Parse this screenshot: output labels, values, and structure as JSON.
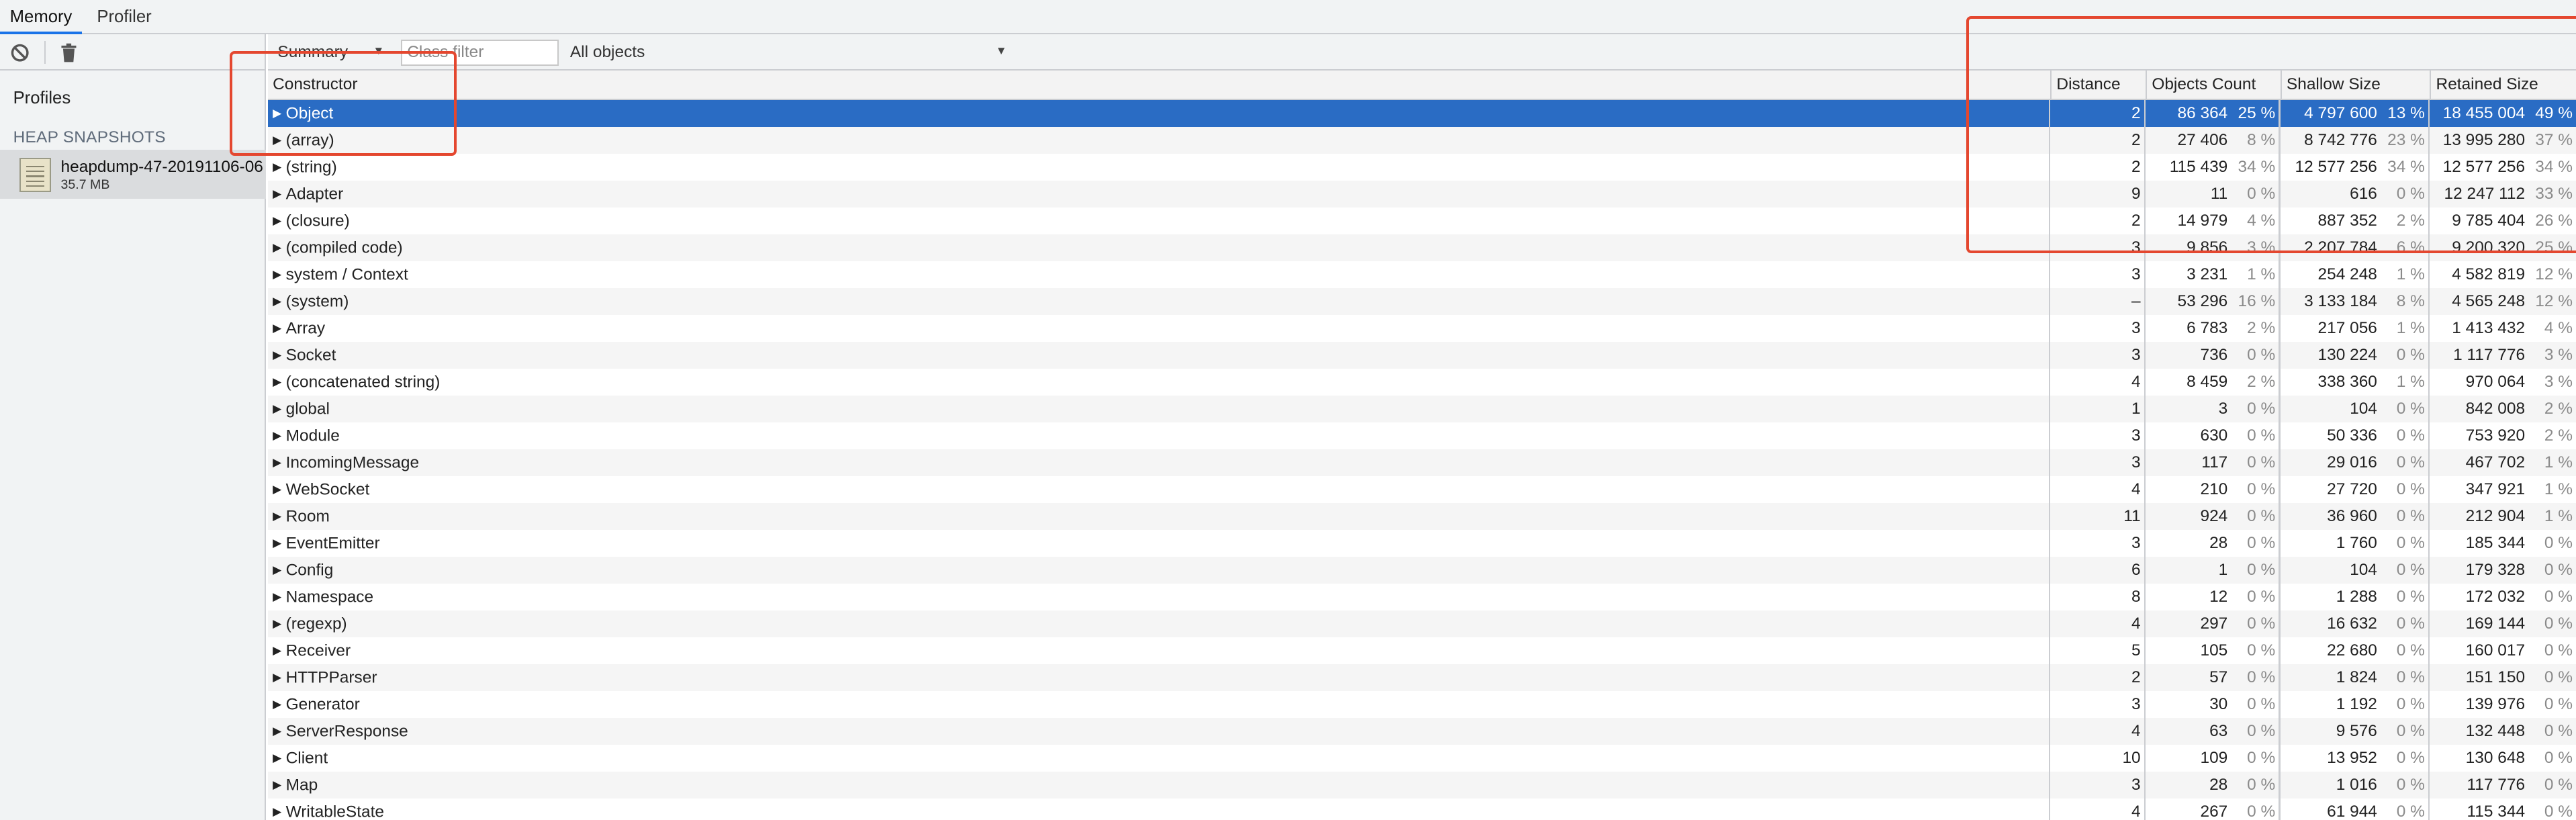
{
  "tabs": [
    "Memory",
    "Profiler"
  ],
  "left_panel": {
    "profiles_title": "Profiles",
    "section_title": "HEAP SNAPSHOTS",
    "snapshot": {
      "name": "heapdump-47-20191106-06",
      "size": "35.7 MB"
    }
  },
  "toolbar": {
    "view": "Summary",
    "class_filter_placeholder": "Class filter",
    "objects_filter": "All objects"
  },
  "table": {
    "columns": {
      "constructor": "Constructor",
      "distance": "Distance",
      "objects_count": "Objects Count",
      "shallow_size": "Shallow Size",
      "retained_size": "Retained Size"
    },
    "rows": [
      {
        "name": "Object",
        "distance": "2",
        "count": "86 364",
        "count_pct": "25 %",
        "shallow": "4 797 600",
        "shallow_pct": "13 %",
        "retained": "18 455 004",
        "retained_pct": "49 %"
      },
      {
        "name": "(array)",
        "distance": "2",
        "count": "27 406",
        "count_pct": "8 %",
        "shallow": "8 742 776",
        "shallow_pct": "23 %",
        "retained": "13 995 280",
        "retained_pct": "37 %"
      },
      {
        "name": "(string)",
        "distance": "2",
        "count": "115 439",
        "count_pct": "34 %",
        "shallow": "12 577 256",
        "shallow_pct": "34 %",
        "retained": "12 577 256",
        "retained_pct": "34 %"
      },
      {
        "name": "Adapter",
        "distance": "9",
        "count": "11",
        "count_pct": "0 %",
        "shallow": "616",
        "shallow_pct": "0 %",
        "retained": "12 247 112",
        "retained_pct": "33 %"
      },
      {
        "name": "(closure)",
        "distance": "2",
        "count": "14 979",
        "count_pct": "4 %",
        "shallow": "887 352",
        "shallow_pct": "2 %",
        "retained": "9 785 404",
        "retained_pct": "26 %"
      },
      {
        "name": "(compiled code)",
        "distance": "3",
        "count": "9 856",
        "count_pct": "3 %",
        "shallow": "2 207 784",
        "shallow_pct": "6 %",
        "retained": "9 200 320",
        "retained_pct": "25 %"
      },
      {
        "name": "system / Context",
        "distance": "3",
        "count": "3 231",
        "count_pct": "1 %",
        "shallow": "254 248",
        "shallow_pct": "1 %",
        "retained": "4 582 819",
        "retained_pct": "12 %"
      },
      {
        "name": "(system)",
        "distance": "–",
        "count": "53 296",
        "count_pct": "16 %",
        "shallow": "3 133 184",
        "shallow_pct": "8 %",
        "retained": "4 565 248",
        "retained_pct": "12 %"
      },
      {
        "name": "Array",
        "distance": "3",
        "count": "6 783",
        "count_pct": "2 %",
        "shallow": "217 056",
        "shallow_pct": "1 %",
        "retained": "1 413 432",
        "retained_pct": "4 %"
      },
      {
        "name": "Socket",
        "distance": "3",
        "count": "736",
        "count_pct": "0 %",
        "shallow": "130 224",
        "shallow_pct": "0 %",
        "retained": "1 117 776",
        "retained_pct": "3 %"
      },
      {
        "name": "(concatenated string)",
        "distance": "4",
        "count": "8 459",
        "count_pct": "2 %",
        "shallow": "338 360",
        "shallow_pct": "1 %",
        "retained": "970 064",
        "retained_pct": "3 %"
      },
      {
        "name": "global",
        "distance": "1",
        "count": "3",
        "count_pct": "0 %",
        "shallow": "104",
        "shallow_pct": "0 %",
        "retained": "842 008",
        "retained_pct": "2 %"
      },
      {
        "name": "Module",
        "distance": "3",
        "count": "630",
        "count_pct": "0 %",
        "shallow": "50 336",
        "shallow_pct": "0 %",
        "retained": "753 920",
        "retained_pct": "2 %"
      },
      {
        "name": "IncomingMessage",
        "distance": "3",
        "count": "117",
        "count_pct": "0 %",
        "shallow": "29 016",
        "shallow_pct": "0 %",
        "retained": "467 702",
        "retained_pct": "1 %"
      },
      {
        "name": "WebSocket",
        "distance": "4",
        "count": "210",
        "count_pct": "0 %",
        "shallow": "27 720",
        "shallow_pct": "0 %",
        "retained": "347 921",
        "retained_pct": "1 %"
      },
      {
        "name": "Room",
        "distance": "11",
        "count": "924",
        "count_pct": "0 %",
        "shallow": "36 960",
        "shallow_pct": "0 %",
        "retained": "212 904",
        "retained_pct": "1 %"
      },
      {
        "name": "EventEmitter",
        "distance": "3",
        "count": "28",
        "count_pct": "0 %",
        "shallow": "1 760",
        "shallow_pct": "0 %",
        "retained": "185 344",
        "retained_pct": "0 %"
      },
      {
        "name": "Config",
        "distance": "6",
        "count": "1",
        "count_pct": "0 %",
        "shallow": "104",
        "shallow_pct": "0 %",
        "retained": "179 328",
        "retained_pct": "0 %"
      },
      {
        "name": "Namespace",
        "distance": "8",
        "count": "12",
        "count_pct": "0 %",
        "shallow": "1 288",
        "shallow_pct": "0 %",
        "retained": "172 032",
        "retained_pct": "0 %"
      },
      {
        "name": "(regexp)",
        "distance": "4",
        "count": "297",
        "count_pct": "0 %",
        "shallow": "16 632",
        "shallow_pct": "0 %",
        "retained": "169 144",
        "retained_pct": "0 %"
      },
      {
        "name": "Receiver",
        "distance": "5",
        "count": "105",
        "count_pct": "0 %",
        "shallow": "22 680",
        "shallow_pct": "0 %",
        "retained": "160 017",
        "retained_pct": "0 %"
      },
      {
        "name": "HTTPParser",
        "distance": "2",
        "count": "57",
        "count_pct": "0 %",
        "shallow": "1 824",
        "shallow_pct": "0 %",
        "retained": "151 150",
        "retained_pct": "0 %"
      },
      {
        "name": "Generator",
        "distance": "3",
        "count": "30",
        "count_pct": "0 %",
        "shallow": "1 192",
        "shallow_pct": "0 %",
        "retained": "139 976",
        "retained_pct": "0 %"
      },
      {
        "name": "ServerResponse",
        "distance": "4",
        "count": "63",
        "count_pct": "0 %",
        "shallow": "9 576",
        "shallow_pct": "0 %",
        "retained": "132 448",
        "retained_pct": "0 %"
      },
      {
        "name": "Client",
        "distance": "10",
        "count": "109",
        "count_pct": "0 %",
        "shallow": "13 952",
        "shallow_pct": "0 %",
        "retained": "130 648",
        "retained_pct": "0 %"
      },
      {
        "name": "Map",
        "distance": "3",
        "count": "28",
        "count_pct": "0 %",
        "shallow": "1 016",
        "shallow_pct": "0 %",
        "retained": "117 776",
        "retained_pct": "0 %"
      },
      {
        "name": "WritableState",
        "distance": "4",
        "count": "267",
        "count_pct": "0 %",
        "shallow": "61 944",
        "shallow_pct": "0 %",
        "retained": "115 344",
        "retained_pct": "0 %"
      }
    ]
  },
  "colors": {
    "selection": "#2a6cc4",
    "annotation": "#e4472f",
    "tab_active": "#1a73e8"
  }
}
